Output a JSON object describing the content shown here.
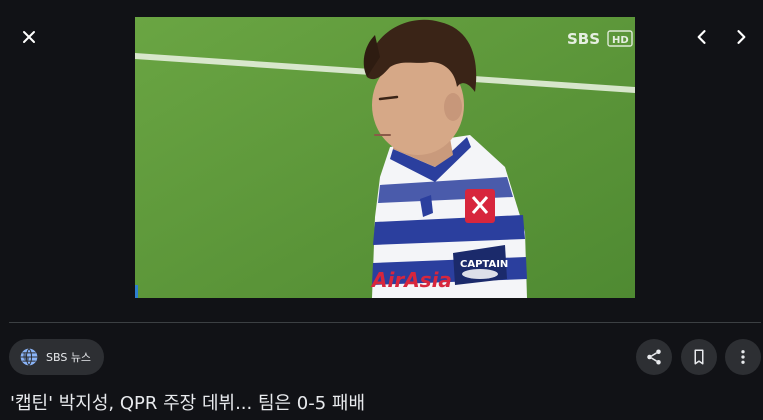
{
  "toolbar": {
    "close_icon": "close-icon",
    "prev_icon": "chevron-left-icon",
    "next_icon": "chevron-right-icon"
  },
  "image": {
    "broadcaster_watermark": "SBS HD",
    "sponsor_text": "AirAsia",
    "armband_text": "CAPTAIN"
  },
  "source": {
    "icon": "globe-icon",
    "name": "SBS 뉴스"
  },
  "actions": {
    "share_icon": "share-icon",
    "save_icon": "bookmark-icon",
    "more_icon": "more-vert-icon"
  },
  "caption": "'캡틴' 박지성, QPR 주장 데뷔... 팀은 0-5 패배",
  "colors": {
    "background": "#111216",
    "chip": "#2d2f33",
    "accent": "#8ab4f8",
    "pitch": "#5e9a3c"
  }
}
